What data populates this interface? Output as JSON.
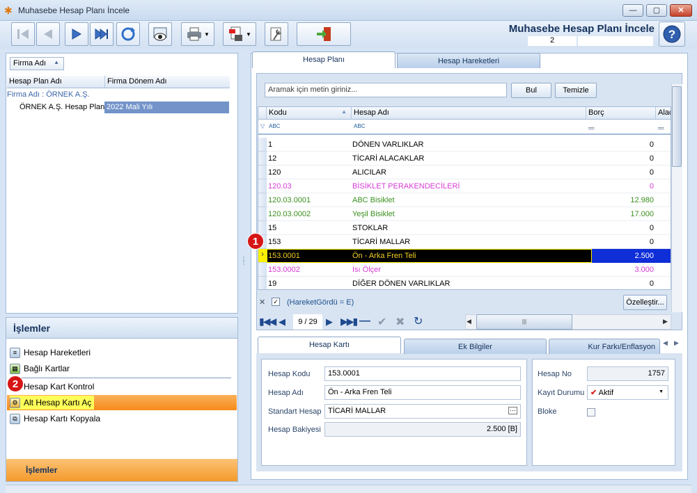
{
  "window": {
    "title": "Muhasebe Hesap Planı İncele",
    "min": "—",
    "max": "▢",
    "close": "✕"
  },
  "header": {
    "form_title": "Muhasebe Hesap Planı İncele",
    "form_number": "2"
  },
  "left": {
    "sort_button": "Firma Adı",
    "columns": [
      "Hesap Plan Adı",
      "Firma Dönem Adı"
    ],
    "group_label": "Firma Adı : ÖRNEK A.Ş.",
    "row": {
      "plan": "ÖRNEK A.Ş. Hesap Planı",
      "period": "2022 Mali Yılı"
    }
  },
  "islemler": {
    "title": "İşlemler",
    "items": [
      "Hesap Hareketleri",
      "Bağlı Kartlar",
      "Hesap Kart Kontrol",
      "Alt Hesap Kartı Aç",
      "Hesap Kartı Kopyala"
    ],
    "footer": "İşlemler"
  },
  "markers": [
    "1",
    "2"
  ],
  "tabs": [
    "Hesap Planı",
    "Hesap Hareketleri"
  ],
  "search": {
    "placeholder": "Aramak için metin giriniz...",
    "find": "Bul",
    "clear": "Temizle"
  },
  "grid": {
    "columns": [
      "Kodu",
      "Hesap Adı",
      "Borç",
      "Alac"
    ],
    "filter_tag": "ABC",
    "rows": [
      {
        "code": "1",
        "name": "DÖNEN VARLIKLAR",
        "debt": "0",
        "color": "#000000"
      },
      {
        "code": "12",
        "name": "TİCARİ ALACAKLAR",
        "debt": "0",
        "color": "#000000"
      },
      {
        "code": "120",
        "name": "ALICILAR",
        "debt": "0",
        "color": "#000000"
      },
      {
        "code": "120.03",
        "name": "BİSİKLET PERAKENDECİLERİ",
        "debt": "0",
        "color": "#d63ad6"
      },
      {
        "code": "120.03.0001",
        "name": "ABC Bisiklet",
        "debt": "12.980",
        "color": "#3a8f1e"
      },
      {
        "code": "120.03.0002",
        "name": "Yeşil Bisiklet",
        "debt": "17.000",
        "color": "#3a8f1e"
      },
      {
        "code": "15",
        "name": "STOKLAR",
        "debt": "0",
        "color": "#000000"
      },
      {
        "code": "153",
        "name": "TİCARİ MALLAR",
        "debt": "0",
        "color": "#000000"
      },
      {
        "code": "153.0001",
        "name": "Ön - Arka Fren Teli",
        "debt": "2.500",
        "color": "#f0d020"
      },
      {
        "code": "153.0002",
        "name": "Isı Ölçer",
        "debt": "3.000",
        "color": "#d63ad6"
      },
      {
        "code": "19",
        "name": "DİĞER DÖNEN VARLIKLAR",
        "debt": "0",
        "color": "#000000"
      }
    ],
    "filter_text": "(HareketGördü = E)",
    "customize": "Özelleştir...",
    "page": "9 / 29"
  },
  "bottom_tabs": [
    "Hesap Kartı",
    "Ek Bilgiler",
    "Kur Farkı/Enflasyon"
  ],
  "card": {
    "labels": [
      "Hesap Kodu",
      "Hesap Adı",
      "Standart Hesap",
      "Hesap Bakiyesi"
    ],
    "values": [
      "153.0001",
      "Ön - Arka Fren Teli",
      "TİCARİ MALLAR",
      "2.500 [B]"
    ],
    "right_labels": [
      "Hesap No",
      "Kayıt Durumu",
      "Bloke"
    ],
    "hesap_no": "1757",
    "status": "Aktif"
  },
  "colors": {
    "selected_row": "#000000",
    "selected_text": "#f0d020",
    "borc_highlight": "#0f2ed8",
    "accent_orange": "#f58a1a"
  }
}
